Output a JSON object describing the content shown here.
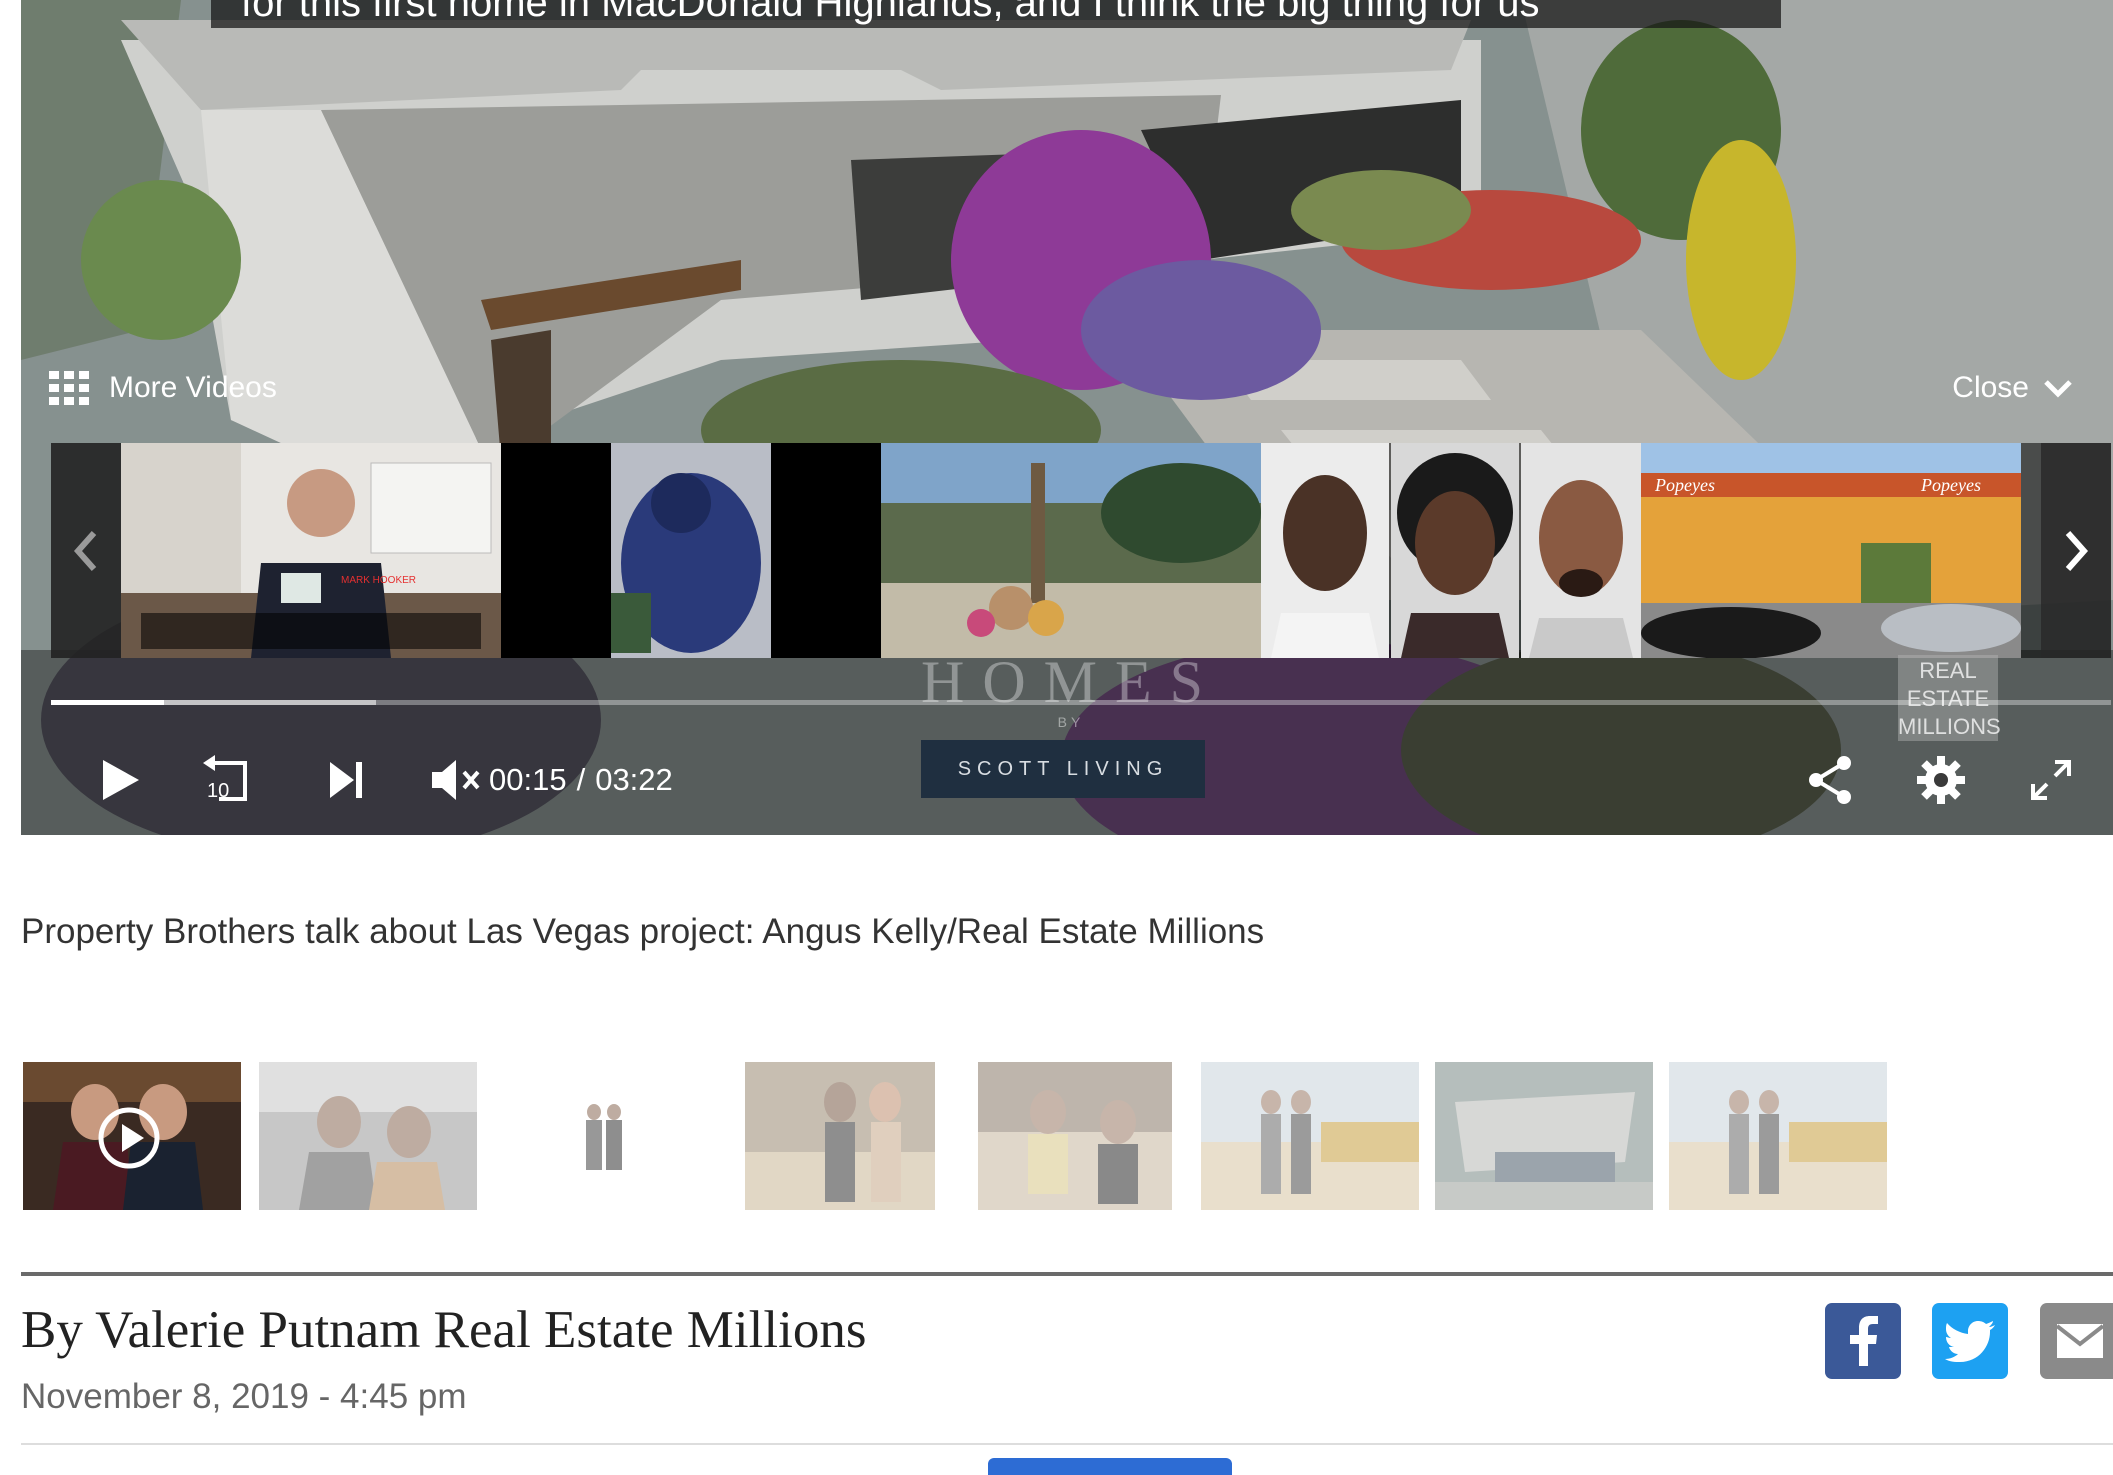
{
  "player": {
    "caption": "for this first home in MacDonald Highlands, and I think the big thing for us",
    "more_videos_label": "More Videos",
    "close_label": "Close",
    "current_time": "00:15",
    "time_separator": "/",
    "duration": "03:22",
    "progress_played_fraction": 0.055,
    "progress_buffered_fraction": 0.158,
    "replay_seconds": "10",
    "watermark_homes": "HOMES",
    "watermark_by": "BY",
    "watermark_brand": "SCOTT LIVING",
    "watermark_rem": [
      "REAL",
      "ESTATE",
      "MILLIONS"
    ]
  },
  "carousel": {
    "thumbs": [
      {
        "name": "carousel-thumb-kitchen-host",
        "caption_top": "MARK HOOKER"
      },
      {
        "name": "carousel-thumb-blue-figure"
      },
      {
        "name": "carousel-thumb-memorial-yard"
      },
      {
        "name": "carousel-thumb-mugshot-man-1"
      },
      {
        "name": "carousel-thumb-mugshot-woman"
      },
      {
        "name": "carousel-thumb-mugshot-man-2"
      },
      {
        "name": "carousel-thumb-popeyes",
        "sign": "Popeyes"
      }
    ]
  },
  "video_title": "Property Brothers talk about Las Vegas project: Angus Kelly/Real Estate Millions",
  "strip": {
    "count": 8
  },
  "article": {
    "byline": "By Valerie Putnam Real Estate Millions",
    "date": "November 8, 2019 - 4:45 pm"
  },
  "colors": {
    "facebook": "#3b5998",
    "twitter": "#1da1f2",
    "email": "#8a8a8a",
    "brand_navy": "#1f2f40"
  },
  "icons": [
    "play-icon",
    "replay-10-icon",
    "skip-next-icon",
    "mute-icon",
    "share-icon",
    "gear-icon",
    "fullscreen-icon",
    "grid-icon",
    "chevron-down-icon",
    "chevron-left-icon",
    "chevron-right-icon",
    "facebook-icon",
    "twitter-icon",
    "mail-icon"
  ]
}
